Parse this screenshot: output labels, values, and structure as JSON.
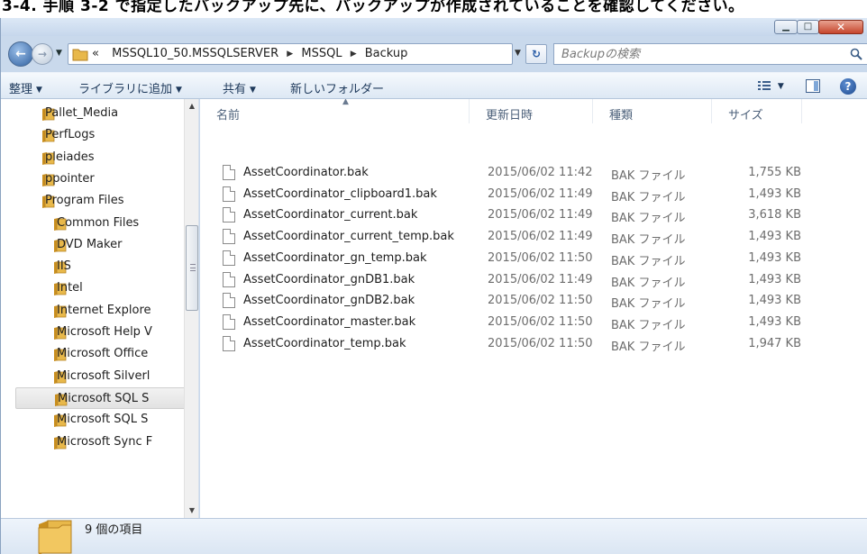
{
  "banner": {
    "text": "3-4. 手順 3-2 で指定したバックアップ先に、バックアップが作成されていることを確認してください。"
  },
  "address": {
    "prefix": "«",
    "crumbs": [
      "MSSQL10_50.MSSQLSERVER",
      "MSSQL",
      "Backup"
    ]
  },
  "search": {
    "placeholder": "Backupの検索"
  },
  "toolbar": {
    "organize": "整理",
    "add_to_library": "ライブラリに追加",
    "share": "共有",
    "new_folder": "新しいフォルダー"
  },
  "nav": {
    "items": [
      "Pallet_Media",
      "PerfLogs",
      "pleiades",
      "ppointer",
      "Program Files",
      "Common Files",
      "DVD Maker",
      "IIS",
      "Intel",
      "Internet Explore",
      "Microsoft Help V",
      "Microsoft Office",
      "Microsoft Silverl",
      "Microsoft SQL S",
      "Microsoft SQL S",
      "Microsoft Sync F"
    ]
  },
  "columns": {
    "name": "名前",
    "date": "更新日時",
    "type": "種類",
    "size": "サイズ"
  },
  "files": [
    {
      "name": "AssetCoordinator.bak",
      "date": "2015/06/02 11:42",
      "type": "BAK ファイル",
      "size": "1,755 KB"
    },
    {
      "name": "AssetCoordinator_clipboard1.bak",
      "date": "2015/06/02 11:49",
      "type": "BAK ファイル",
      "size": "1,493 KB"
    },
    {
      "name": "AssetCoordinator_current.bak",
      "date": "2015/06/02 11:49",
      "type": "BAK ファイル",
      "size": "3,618 KB"
    },
    {
      "name": "AssetCoordinator_current_temp.bak",
      "date": "2015/06/02 11:49",
      "type": "BAK ファイル",
      "size": "1,493 KB"
    },
    {
      "name": "AssetCoordinator_gn_temp.bak",
      "date": "2015/06/02 11:50",
      "type": "BAK ファイル",
      "size": "1,493 KB"
    },
    {
      "name": "AssetCoordinator_gnDB1.bak",
      "date": "2015/06/02 11:49",
      "type": "BAK ファイル",
      "size": "1,493 KB"
    },
    {
      "name": "AssetCoordinator_gnDB2.bak",
      "date": "2015/06/02 11:50",
      "type": "BAK ファイル",
      "size": "1,493 KB"
    },
    {
      "name": "AssetCoordinator_master.bak",
      "date": "2015/06/02 11:50",
      "type": "BAK ファイル",
      "size": "1,493 KB"
    },
    {
      "name": "AssetCoordinator_temp.bak",
      "date": "2015/06/02 11:50",
      "type": "BAK ファイル",
      "size": "1,947 KB"
    }
  ],
  "status": {
    "item_count": "9 個の項目"
  },
  "colors": {
    "folder": "#e8b84a",
    "folder_dark": "#c98f1f",
    "accent": "#1e395b"
  }
}
